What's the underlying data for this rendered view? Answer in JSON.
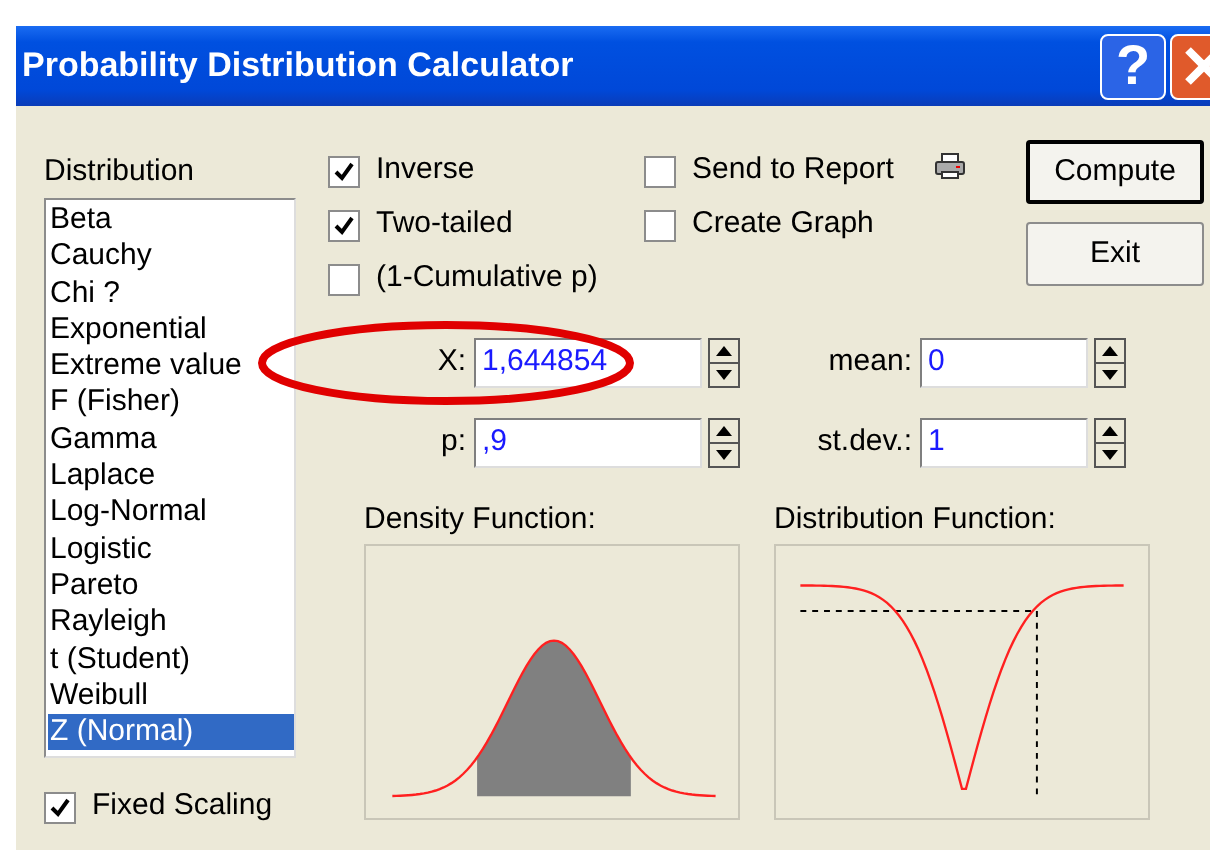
{
  "window": {
    "title": "Probability Distribution Calculator",
    "help_button": "?"
  },
  "distribution": {
    "label": "Distribution",
    "items": [
      {
        "label": "Beta",
        "selected": false
      },
      {
        "label": "Cauchy",
        "selected": false
      },
      {
        "label": "Chi ?",
        "selected": false
      },
      {
        "label": "Exponential",
        "selected": false
      },
      {
        "label": "Extreme value",
        "selected": false
      },
      {
        "label": "F (Fisher)",
        "selected": false
      },
      {
        "label": "Gamma",
        "selected": false
      },
      {
        "label": "Laplace",
        "selected": false
      },
      {
        "label": "Log-Normal",
        "selected": false
      },
      {
        "label": "Logistic",
        "selected": false
      },
      {
        "label": "Pareto",
        "selected": false
      },
      {
        "label": "Rayleigh",
        "selected": false
      },
      {
        "label": "t (Student)",
        "selected": false
      },
      {
        "label": "Weibull",
        "selected": false
      },
      {
        "label": "Z (Normal)",
        "selected": true
      }
    ]
  },
  "options": [
    {
      "label": "Inverse",
      "checked": true
    },
    {
      "label": "Two-tailed",
      "checked": true
    },
    {
      "label": "(1-Cumulative p)",
      "checked": false
    }
  ],
  "output_options": [
    {
      "label": "Send to Report",
      "checked": false
    },
    {
      "label": "Create Graph",
      "checked": false
    }
  ],
  "buttons": [
    {
      "label": "Compute",
      "default": true
    },
    {
      "label": "Exit",
      "default": false
    }
  ],
  "fields": [
    {
      "label": "X:",
      "value": "1,644854",
      "highlighted": true
    },
    {
      "label": "mean:",
      "value": "0",
      "highlighted": false
    },
    {
      "label": "p:",
      "value": ",9",
      "highlighted": false
    },
    {
      "label": "st.dev.:",
      "value": "1",
      "highlighted": false
    }
  ],
  "charts": [
    {
      "kind": "density",
      "title": "Density Function:"
    },
    {
      "kind": "distribution",
      "title": "Distribution Function:"
    }
  ],
  "fixed_scaling": {
    "label": "Fixed Scaling",
    "checked": true
  }
}
